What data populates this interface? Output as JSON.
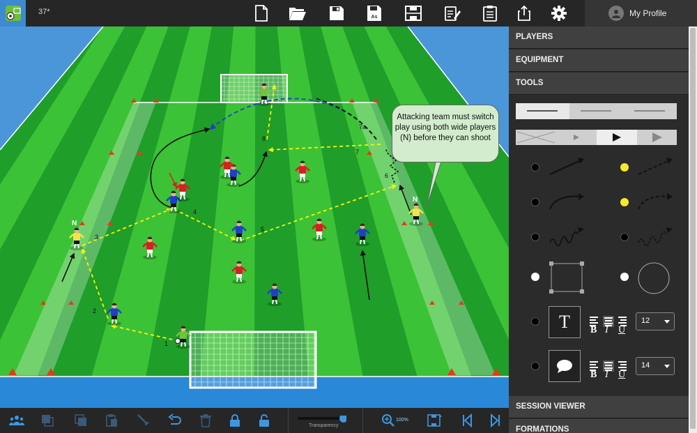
{
  "app": {
    "document_title": "37*",
    "profile_label": "My Profile"
  },
  "toolbar": {
    "icons": [
      "new-file-icon",
      "open-folder-icon",
      "save-icon",
      "save-as-icon",
      "pitch-icon",
      "edit-notes-icon",
      "clipboard-icon",
      "share-icon",
      "gear-icon"
    ],
    "save_as_label": "As"
  },
  "canvas": {
    "tooltip_text": "Attacking team must switch play using both wide players (N) before they can shoot",
    "wide_player_labels": [
      "N",
      "N"
    ],
    "pass_numbers": [
      "1",
      "2",
      "3",
      "4",
      "5",
      "6",
      "7",
      "7a",
      "8"
    ],
    "colors": {
      "grass_dark": "#1f9e2a",
      "grass_light": "#3cc236",
      "sky": "#4a96d8",
      "pass_line": "#f5f50a",
      "team_blue": "#1f3fc8",
      "team_red": "#d71f1f",
      "wide_player": "#f3e44a",
      "goalkeeper": "#6fc63a",
      "cone": "#e23b1c"
    }
  },
  "bottombar": {
    "transparency_label": "Transparency",
    "zoom_label": "100%"
  },
  "panel": {
    "sections": {
      "players": "PLAYERS",
      "equipment": "EQUIPMENT",
      "tools": "TOOLS",
      "session_viewer": "SESSION VIEWER",
      "formations": "FORMATIONS"
    },
    "text_tool_glyph": "T",
    "bold_glyph": "B",
    "italic_glyph": "I",
    "underline_glyph": "U",
    "text_size": "12",
    "callout_size": "14",
    "dot_colors": {
      "black": "#000000",
      "yellow": "#f5ea2a",
      "white": "#ffffff"
    }
  }
}
